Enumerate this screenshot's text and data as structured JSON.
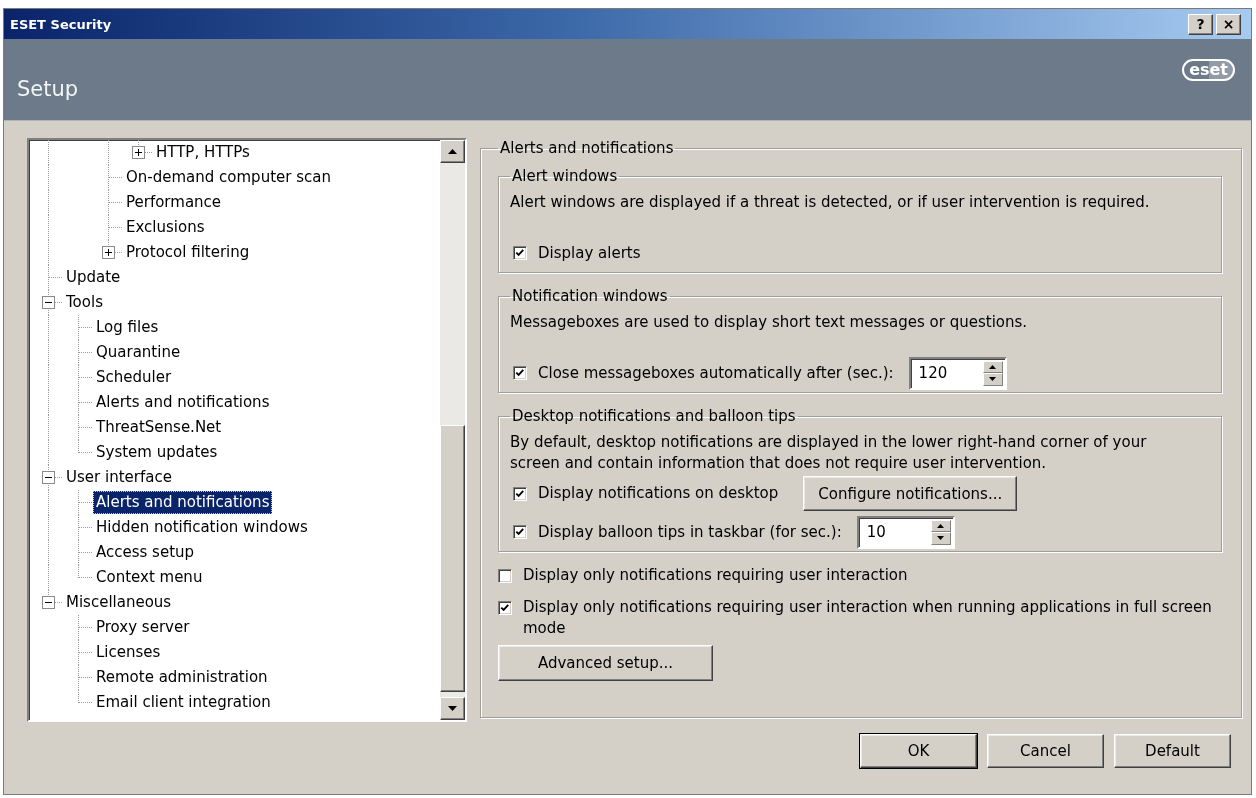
{
  "window": {
    "title": "ESET Security",
    "buttons": [
      {
        "kind": "help",
        "label": "?"
      },
      {
        "kind": "close",
        "label": "×"
      }
    ]
  },
  "header": {
    "title": "Setup",
    "logo": "eset"
  },
  "tree": {
    "items": [
      {
        "children": [
          {
            "children": [
              {
                "children": [
                  {
                    "label": "HTTP, HTTPs",
                    "expanded": false,
                    "selected": false
                  }
                ]
              },
              {
                "label": "On-demand computer scan",
                "selected": false
              },
              {
                "label": "Performance",
                "selected": false
              },
              {
                "label": "Exclusions",
                "selected": false
              },
              {
                "label": "Protocol filtering",
                "expanded": false,
                "selected": false
              }
            ]
          }
        ]
      },
      {
        "label": "Update",
        "selected": false
      },
      {
        "label": "Tools",
        "expanded": true,
        "selected": false,
        "children": [
          {
            "label": "Log files",
            "selected": false
          },
          {
            "label": "Quarantine",
            "selected": false
          },
          {
            "label": "Scheduler",
            "selected": false
          },
          {
            "label": "Alerts and notifications",
            "selected": false
          },
          {
            "label": "ThreatSense.Net",
            "selected": false
          },
          {
            "label": "System updates",
            "selected": false
          }
        ]
      },
      {
        "label": "User interface",
        "expanded": true,
        "selected": false,
        "children": [
          {
            "label": "Alerts and notifications",
            "selected": true
          },
          {
            "label": "Hidden notification windows",
            "selected": false
          },
          {
            "label": "Access setup",
            "selected": false
          },
          {
            "label": "Context menu",
            "selected": false
          }
        ]
      },
      {
        "label": "Miscellaneous",
        "expanded": true,
        "selected": false,
        "children": [
          {
            "label": "Proxy server",
            "selected": false
          },
          {
            "label": "Licenses",
            "selected": false
          },
          {
            "label": "Remote administration",
            "selected": false
          },
          {
            "label": "Email client integration",
            "selected": false
          }
        ]
      }
    ]
  },
  "panel": {
    "title": "Alerts and notifications",
    "groups": [
      {
        "title": "Alert windows",
        "description": "Alert windows are displayed if a threat is detected, or if user intervention is required.",
        "options": [
          {
            "kind": "checkbox",
            "label": "Display alerts",
            "checked": true
          }
        ]
      },
      {
        "title": "Notification windows",
        "description": "Messageboxes are used to display short text messages or questions.",
        "options": [
          {
            "kind": "spin",
            "label": "Close messageboxes automatically after (sec.):",
            "checked": true,
            "value": "120"
          }
        ]
      },
      {
        "title": "Desktop notifications and balloon tips",
        "description": "By default, desktop notifications are displayed in the lower right-hand corner of your screen and contain information that does not require user intervention.",
        "options": [
          {
            "kind": "button",
            "label": "Display notifications on desktop",
            "checked": true,
            "button": "Configure notifications..."
          },
          {
            "kind": "spin",
            "label": "Display balloon tips in taskbar (for sec.):",
            "checked": true,
            "value": "10"
          }
        ]
      }
    ],
    "options": [
      {
        "label": "Display only notifications requiring user interaction",
        "checked": false
      },
      {
        "label": "Display only notifications requiring user interaction when running applications in full screen mode",
        "checked": true
      }
    ],
    "advanced_button": "Advanced setup..."
  },
  "buttons": [
    {
      "label": "OK",
      "default": true
    },
    {
      "label": "Cancel",
      "default": false
    },
    {
      "label": "Default",
      "default": false
    }
  ]
}
